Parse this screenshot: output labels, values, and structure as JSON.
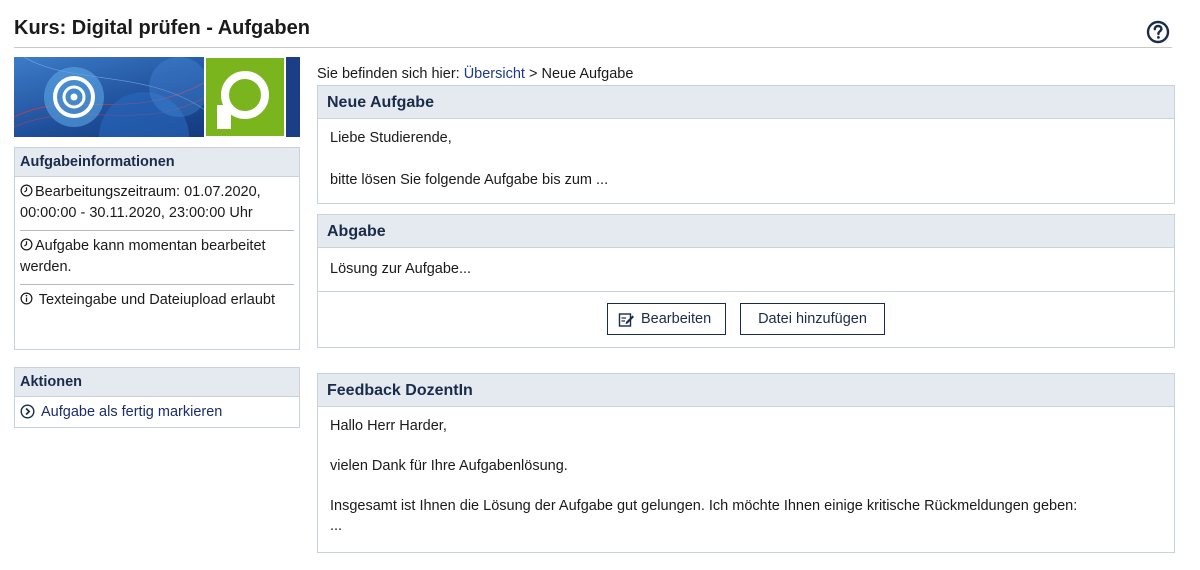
{
  "header": {
    "title": "Kurs: Digital prüfen - Aufgaben"
  },
  "breadcrumb": {
    "prefix": "Sie befinden sich hier:",
    "link": "Übersicht",
    "separator": ">",
    "current": "Neue Aufgabe"
  },
  "sidebar": {
    "info": {
      "heading": "Aufgabeinformationen",
      "items": [
        {
          "icon": "clock-icon",
          "text": "Bearbeitungszeitraum: 01.07.2020, 00:00:00 - 30.11.2020, 23:00:00 Uhr"
        },
        {
          "icon": "clock-icon",
          "text": "Aufgabe kann momentan bearbeitet werden."
        },
        {
          "icon": "info-icon",
          "text": "Texteingabe und Dateiupload erlaubt"
        }
      ]
    },
    "actions": {
      "heading": "Aktionen",
      "items": [
        {
          "icon": "arrow-circle-icon",
          "label": "Aufgabe als fertig markieren"
        }
      ]
    }
  },
  "task": {
    "heading": "Neue Aufgabe",
    "paragraphs": [
      "Liebe Studierende,",
      "bitte lösen Sie folgende Aufgabe bis zum ..."
    ]
  },
  "submission": {
    "heading": "Abgabe",
    "text": "Lösung zur Aufgabe...",
    "edit_label": "Bearbeiten",
    "add_file_label": "Datei hinzufügen"
  },
  "feedback": {
    "heading": "Feedback DozentIn",
    "paragraphs": [
      "Hallo Herr Harder,",
      "vielen Dank für Ihre Aufgabenlösung.",
      "Insgesamt ist Ihnen die Lösung der Aufgabe gut gelungen. Ich möchte Ihnen einige kritische Rückmeldungen geben:",
      "..."
    ]
  },
  "colors": {
    "accent": "#1b2c4a",
    "panel_head": "#e4eaf0",
    "logo_green": "#7ab51d",
    "banner_blue": "#1f5aa8"
  }
}
